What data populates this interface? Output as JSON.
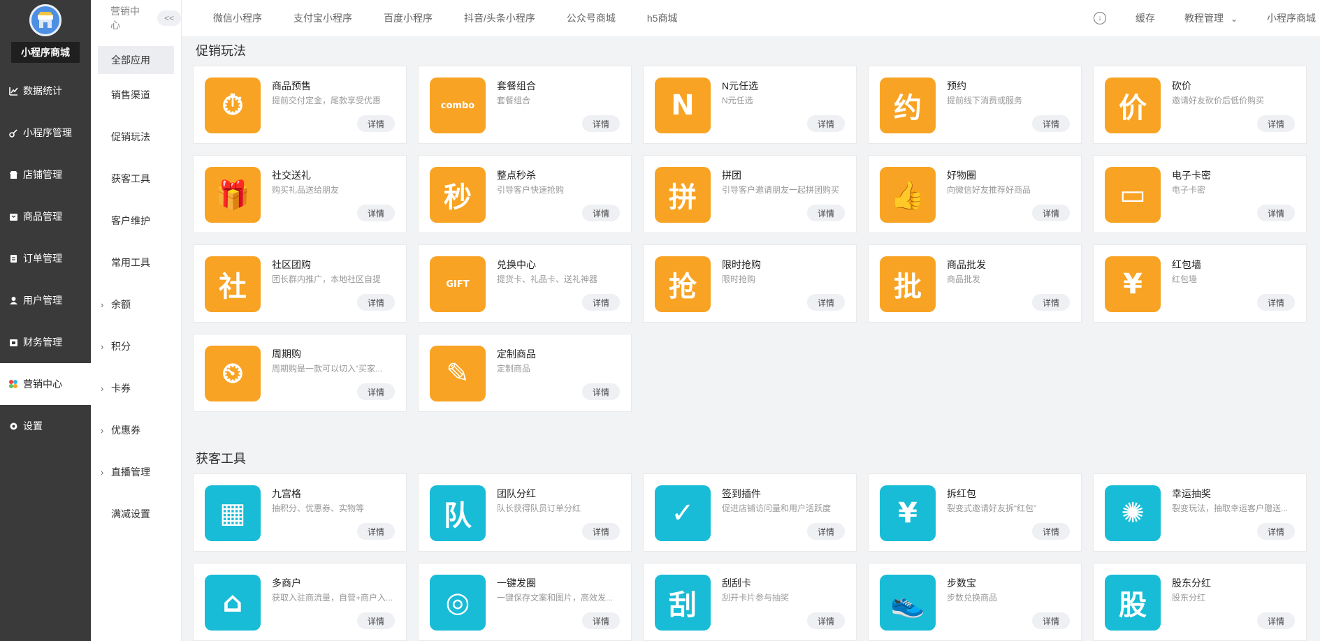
{
  "app": {
    "store_name": "小程序商城"
  },
  "sidebar": {
    "items": [
      {
        "label": "数据统计",
        "icon": "bar-chart-icon"
      },
      {
        "label": "小程序管理",
        "icon": "link-icon"
      },
      {
        "label": "店铺管理",
        "icon": "shop-icon"
      },
      {
        "label": "商品管理",
        "icon": "box-icon"
      },
      {
        "label": "订单管理",
        "icon": "clipboard-icon"
      },
      {
        "label": "用户管理",
        "icon": "user-icon"
      },
      {
        "label": "财务管理",
        "icon": "wallet-icon"
      },
      {
        "label": "营销中心",
        "icon": "marketing-icon",
        "active": true
      },
      {
        "label": "设置",
        "icon": "gear-icon"
      }
    ]
  },
  "subnav": {
    "header": "营销中心",
    "collapse_label": "<<",
    "items": [
      {
        "label": "全部应用",
        "active": true
      },
      {
        "label": "销售渠道"
      },
      {
        "label": "促销玩法"
      },
      {
        "label": "获客工具"
      },
      {
        "label": "客户维护"
      },
      {
        "label": "常用工具"
      },
      {
        "label": "余额",
        "expandable": true
      },
      {
        "label": "积分",
        "expandable": true
      },
      {
        "label": "卡券",
        "expandable": true
      },
      {
        "label": "优惠券",
        "expandable": true
      },
      {
        "label": "直播管理",
        "expandable": true
      },
      {
        "label": "满减设置"
      }
    ]
  },
  "topbar": {
    "channels": [
      "微信小程序",
      "支付宝小程序",
      "百度小程序",
      "抖音/头条小程序",
      "公众号商城",
      "h5商城"
    ],
    "cache_label": "缓存",
    "tutorial_label": "教程管理",
    "tutorial_chevron": "⌄",
    "mini_mall_label": "小程序商城",
    "download_icon": "download-icon"
  },
  "sections": [
    {
      "title": "促销玩法",
      "color": "#f8a323",
      "cards": [
        {
          "title": "商品预售",
          "desc": "提前交付定金，尾款享受优惠",
          "btn": "详情",
          "icon": "presale-bag-icon",
          "glyph": "⏱"
        },
        {
          "title": "套餐组合",
          "desc": "套餐组合",
          "btn": "详情",
          "icon": "combo-icon",
          "glyph": "combo"
        },
        {
          "title": "N元任选",
          "desc": "N元任选",
          "btn": "详情",
          "icon": "n-letter-icon",
          "glyph": "N"
        },
        {
          "title": "预约",
          "desc": "提前线下消费或服务",
          "btn": "详情",
          "icon": "appointment-icon",
          "glyph": "约"
        },
        {
          "title": "砍价",
          "desc": "邀请好友砍价后低价购买",
          "btn": "详情",
          "icon": "bargain-icon",
          "glyph": "价"
        },
        {
          "title": "社交送礼",
          "desc": "购买礼品送给朋友",
          "btn": "详情",
          "icon": "gift-hand-icon",
          "glyph": "🎁"
        },
        {
          "title": "整点秒杀",
          "desc": "引导客户快速抢购",
          "btn": "详情",
          "icon": "flash-sale-icon",
          "glyph": "秒"
        },
        {
          "title": "拼团",
          "desc": "引导客户邀请朋友一起拼团购买",
          "btn": "详情",
          "icon": "group-buy-icon",
          "glyph": "拼"
        },
        {
          "title": "好物圈",
          "desc": "向微信好友推荐好商品",
          "btn": "详情",
          "icon": "thumbs-up-icon",
          "glyph": "👍"
        },
        {
          "title": "电子卡密",
          "desc": "电子卡密",
          "btn": "详情",
          "icon": "card-key-icon",
          "glyph": "▭"
        },
        {
          "title": "社区团购",
          "desc": "团长群内推广，本地社区自提",
          "btn": "详情",
          "icon": "community-bag-icon",
          "glyph": "社"
        },
        {
          "title": "兑换中心",
          "desc": "提货卡、礼品卡、送礼神器",
          "btn": "详情",
          "icon": "gift-card-icon",
          "glyph": "GIFT"
        },
        {
          "title": "限时抢购",
          "desc": "限时抢购",
          "btn": "详情",
          "icon": "clock-grab-icon",
          "glyph": "抢"
        },
        {
          "title": "商品批发",
          "desc": "商品批发",
          "btn": "详情",
          "icon": "wholesale-icon",
          "glyph": "批"
        },
        {
          "title": "红包墙",
          "desc": "红包墙",
          "btn": "详情",
          "icon": "red-envelope-icon",
          "glyph": "¥"
        },
        {
          "title": "周期购",
          "desc": "周期购是一款可以切入“买家...",
          "btn": "详情",
          "icon": "periodic-bag-icon",
          "glyph": "⏲"
        },
        {
          "title": "定制商品",
          "desc": "定制商品",
          "btn": "详情",
          "icon": "custom-pencil-icon",
          "glyph": "✎"
        }
      ]
    },
    {
      "title": "获客工具",
      "color": "#18bcd6",
      "cards": [
        {
          "title": "九宫格",
          "desc": "抽积分、优惠券、实物等",
          "btn": "详情",
          "icon": "nine-grid-icon",
          "glyph": "▦"
        },
        {
          "title": "团队分红",
          "desc": "队长获得队员订单分红",
          "btn": "详情",
          "icon": "team-dividend-icon",
          "glyph": "队"
        },
        {
          "title": "签到插件",
          "desc": "促进店铺访问量和用户活跃度",
          "btn": "详情",
          "icon": "calendar-check-icon",
          "glyph": "✓"
        },
        {
          "title": "拆红包",
          "desc": "裂变式邀请好友拆“红包”",
          "btn": "详情",
          "icon": "open-envelope-icon",
          "glyph": "¥"
        },
        {
          "title": "幸运抽奖",
          "desc": "裂变玩法，抽取幸运客户赠送...",
          "btn": "详情",
          "icon": "lucky-wheel-icon",
          "glyph": "✺"
        },
        {
          "title": "多商户",
          "desc": "获取入驻商流量，自营+商户入...",
          "btn": "详情",
          "icon": "storefront-icon",
          "glyph": "⌂"
        },
        {
          "title": "一键发圈",
          "desc": "一键保存文案和图片，高效发...",
          "btn": "详情",
          "icon": "aperture-icon",
          "glyph": "◎"
        },
        {
          "title": "刮刮卡",
          "desc": "刮开卡片参与抽奖",
          "btn": "详情",
          "icon": "scratch-card-icon",
          "glyph": "刮"
        },
        {
          "title": "步数宝",
          "desc": "步数兑换商品",
          "btn": "详情",
          "icon": "sneaker-icon",
          "glyph": "👟"
        },
        {
          "title": "股东分红",
          "desc": "股东分红",
          "btn": "详情",
          "icon": "shareholder-icon",
          "glyph": "股"
        }
      ]
    }
  ]
}
